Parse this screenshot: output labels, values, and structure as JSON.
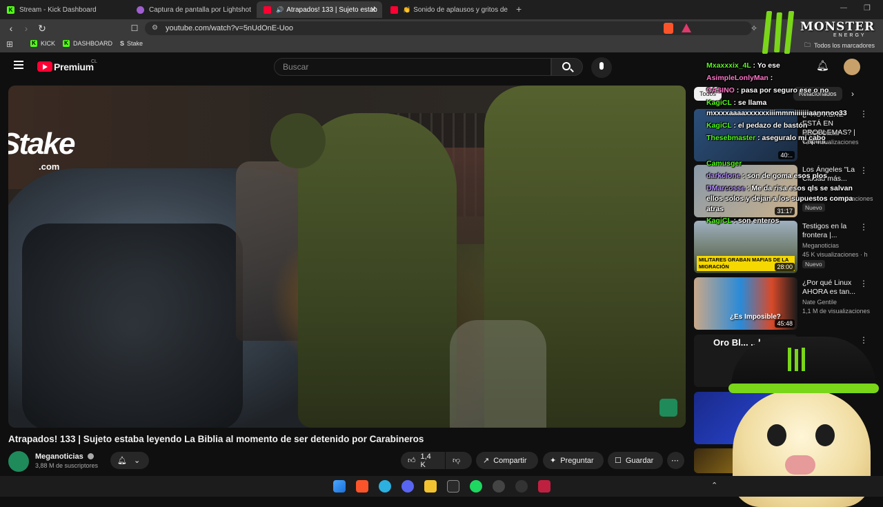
{
  "tabs": [
    {
      "label": "Stream - Kick Dashboard",
      "icon": "kick-icon",
      "active": false
    },
    {
      "label": "Captura de pantalla por Lightshot",
      "icon": "lightshot-icon",
      "active": false
    },
    {
      "label": "Atrapados! 133 | Sujeto estab",
      "icon": "youtube-icon",
      "active": true
    },
    {
      "label": "Sonido de aplausos y gritos del p",
      "icon": "youtube-icon",
      "active": false
    }
  ],
  "address": {
    "url": "youtube.com/watch?v=5nUdOnE-Uoo"
  },
  "bookmarks": [
    {
      "label": "KICK"
    },
    {
      "label": "DASHBOARD"
    },
    {
      "label": "Stake"
    }
  ],
  "bookmarks_all": "Todos los marcadores",
  "overlay": {
    "stake_logo": "Stake",
    "stake_sub": ".com",
    "monster_brand": "MONSTER",
    "monster_sub": "ENERGY"
  },
  "youtube": {
    "logo": "Premium",
    "region": "CL",
    "search_placeholder": "Buscar"
  },
  "video": {
    "title": "Atrapados! 133 | Sujeto estaba leyendo La Biblia al momento de ser detenido por Carabineros",
    "channel": "Meganoticias",
    "subscribers": "3,88 M de suscriptores",
    "likes": "1,4 K",
    "share": "Compartir",
    "ask": "Preguntar",
    "save": "Guardar"
  },
  "filter_chips": [
    "Todos",
    "Relacionados"
  ],
  "recommendations": [
    {
      "title": "¿\"TÍO RENÉ\" ESTÁ EN PROBLEMAS? | Capítul...",
      "channel": "MEGA Oficial",
      "views": "73 K visualizaciones",
      "duration": "40:..",
      "badge": ""
    },
    {
      "title": "Los Ángeles \"La Ciudad más...",
      "channel": "",
      "views": "visualizaciones",
      "duration": "31:17",
      "badge": "Nuevo"
    },
    {
      "title": "Testigos en la frontera |...",
      "channel": "Meganoticias",
      "views": "45 K visualizaciones · h",
      "duration": "28:00",
      "badge": "Nuevo",
      "thumb_text": "MILITARES GRABAN MAFIAS DE LA MIGRACIÓN"
    },
    {
      "title": "¿Por qué Linux AHORA es tan...",
      "channel": "Nate Gentile",
      "views": "1,1 M de visualizaciones",
      "duration": "45:48",
      "badge": "",
      "thumb_text": "¿Es Imposible?"
    },
    {
      "title": "Oro Bl... ...l as",
      "channel": "",
      "views": "",
      "duration": "",
      "badge": ""
    }
  ],
  "chat": [
    {
      "user": "Mxaxxxix_4L",
      "msg": ": Yo ese"
    },
    {
      "user": "AsimpleLonlyMan",
      "msg": ":"
    },
    {
      "user": "CASINO",
      "msg": ": pasa por seguro ese o no"
    },
    {
      "user": "KagiCL",
      "msg": ": se llama"
    },
    {
      "user": "",
      "msg": "mxxxxaaaaxxxxxxiiimmmiiiiiiiaannnoo33"
    },
    {
      "user": "KagiCL",
      "msg": ": el pedazo de bastón"
    },
    {
      "user": "Thesebmaster",
      "msg": ": aseguralo mi cabo"
    },
    {
      "user": "Camusger",
      "msg": ""
    },
    {
      "user": "darkclone",
      "msg": ": son de goma esos plos"
    },
    {
      "user": "DMarcosse",
      "msg": ": Me da risa esos qls se salvan"
    },
    {
      "user": "",
      "msg": "ellos solos y dejan a los supuestos compa"
    },
    {
      "user": "",
      "msg": "atras"
    },
    {
      "user": "KagiCL",
      "msg": ": son enteros"
    }
  ],
  "colors": {
    "youtube_red": "#ff0033",
    "kick_green": "#53fc18",
    "background": "#0f0f0f"
  }
}
